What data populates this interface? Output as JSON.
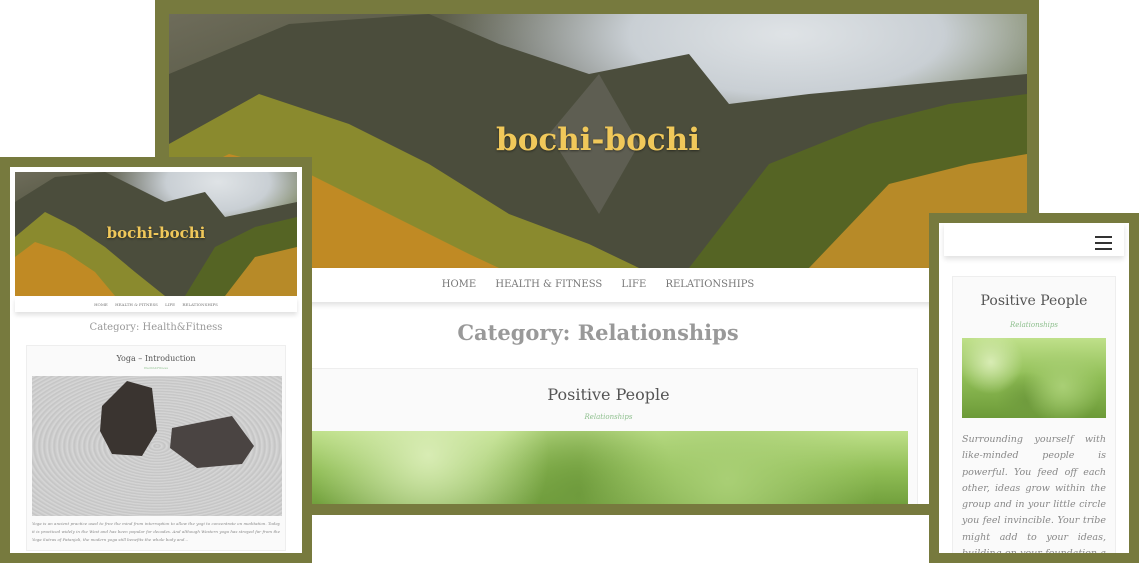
{
  "site": {
    "title": "bochi-bochi"
  },
  "desktop": {
    "nav": [
      "HOME",
      "HEALTH & FITNESS",
      "LIFE",
      "RELATIONSHIPS"
    ],
    "category_title": "Category: Relationships",
    "post": {
      "title": "Positive People",
      "category": "Relationships"
    }
  },
  "tablet": {
    "nav": [
      "HOME",
      "HEALTH & FITNESS",
      "LIFE",
      "RELATIONSHIPS"
    ],
    "category_title": "Category: Health&Fitness",
    "post": {
      "title": "Yoga – Introduction",
      "category": "Health&Fitness",
      "excerpt": "Yoga is an ancient practice used to free the mind from interruption to allow the yogi to concentrate on meditation. Today it is practiced widely in the West and has been popular for decades. And although Western yoga has strayed far from the Yoga Sutras of Patanjali, the modern yoga still benefits the whole body and..."
    }
  },
  "mobile": {
    "menu_icon": "hamburger-menu-icon",
    "post": {
      "title": "Positive People",
      "category": "Relationships",
      "excerpt": "Surrounding yourself with like-minded people is powerful. You feed off each other, ideas grow within the group and in your little circle you feel invincible. Your tribe might add to your ideas, building on your foundation a solid idea with the"
    }
  },
  "colors": {
    "frame": "#777a3e",
    "title": "#f0c85a",
    "category_link": "#8dbf8d"
  }
}
